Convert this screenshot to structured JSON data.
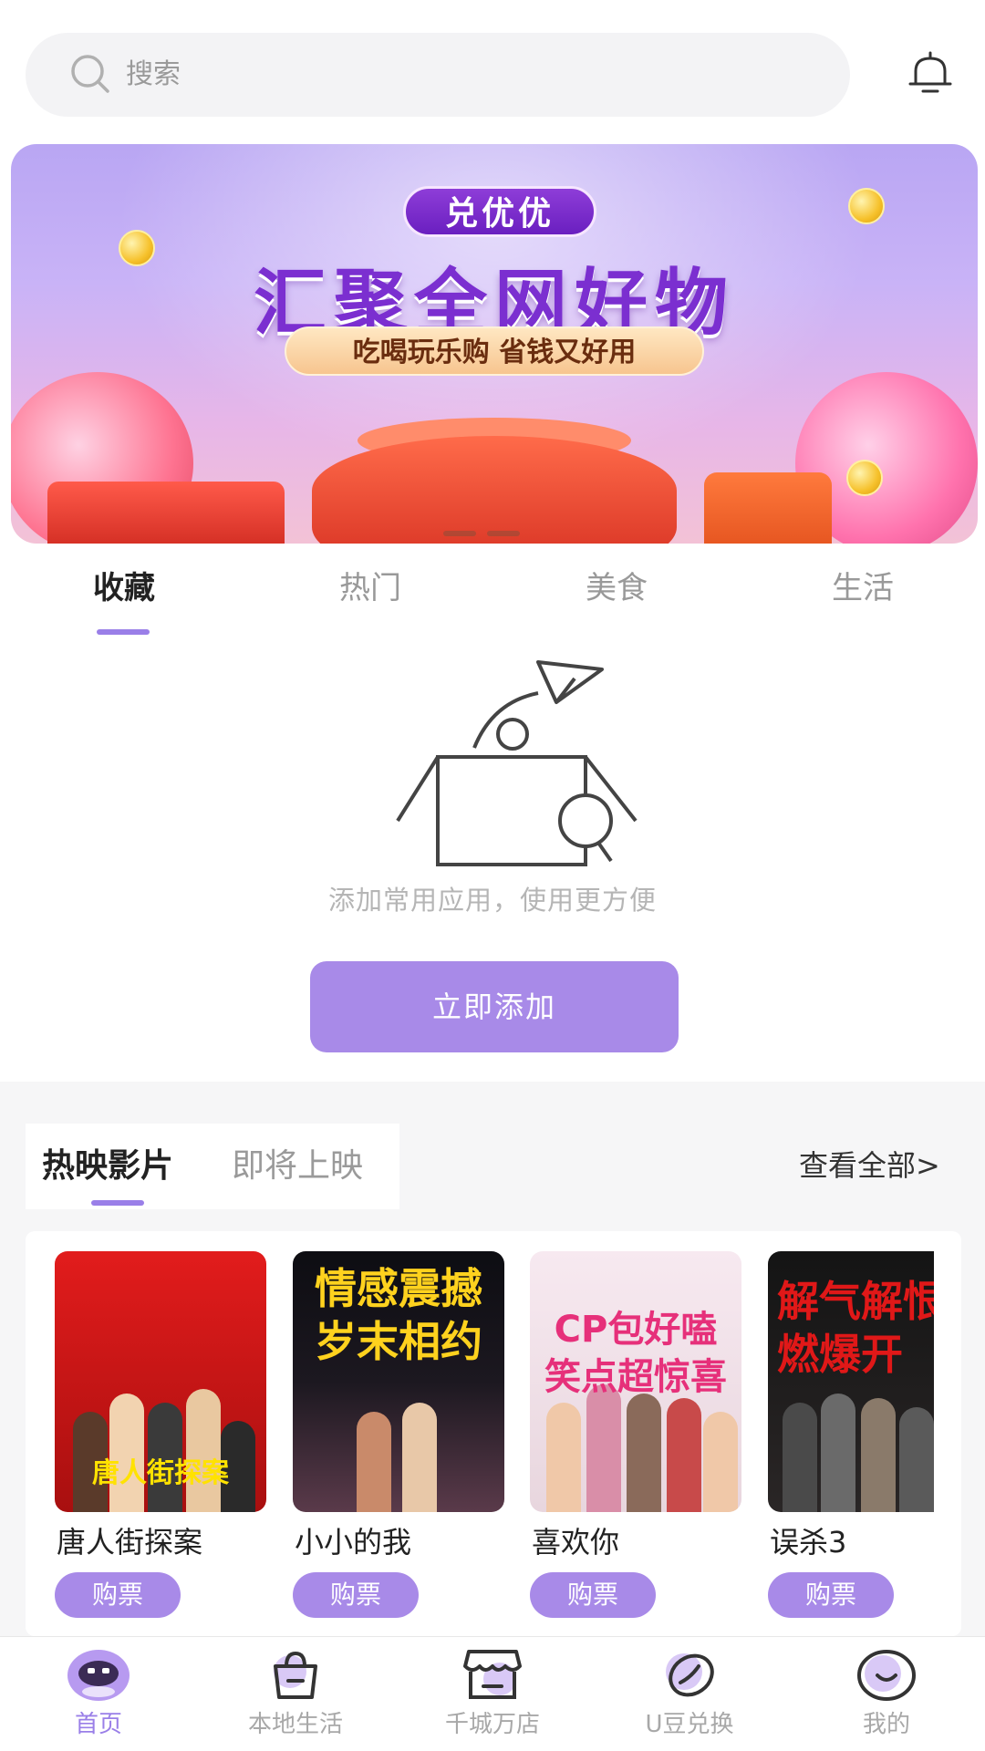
{
  "search": {
    "placeholder": "搜索",
    "icon": "search-icon"
  },
  "header": {
    "notification_icon": "bell-icon"
  },
  "banner": {
    "badge": "兑优优",
    "title": "汇聚全网好物",
    "subtitle": "吃喝玩乐购 省钱又好用",
    "page_indicator_count": 2
  },
  "tabs": [
    {
      "label": "收藏",
      "active": true
    },
    {
      "label": "热门",
      "active": false
    },
    {
      "label": "美食",
      "active": false
    },
    {
      "label": "生活",
      "active": false
    }
  ],
  "empty_state": {
    "text": "添加常用应用，使用更方便",
    "button_label": "立即添加"
  },
  "movies": {
    "tabs": [
      {
        "label": "热映影片",
        "active": true
      },
      {
        "label": "即将上映",
        "active": false
      }
    ],
    "see_all": "查看全部>",
    "items": [
      {
        "name": "唐人街探案",
        "buy_label": "购票",
        "poster_text": "唐人街探案"
      },
      {
        "name": "小小的我",
        "buy_label": "购票",
        "poster_text": "情感震撼岁末相约"
      },
      {
        "name": "喜欢你",
        "buy_label": "购票",
        "poster_text": "CP包好嗑笑点超惊喜"
      },
      {
        "name": "误杀3",
        "buy_label": "购票",
        "poster_text": "解气解恨燃爆开"
      }
    ]
  },
  "bottom_nav": [
    {
      "label": "首页",
      "icon": "robot-home-icon",
      "active": true
    },
    {
      "label": "本地生活",
      "icon": "shopping-bag-icon",
      "active": false
    },
    {
      "label": "千城万店",
      "icon": "storefront-icon",
      "active": false
    },
    {
      "label": "U豆兑换",
      "icon": "bean-exchange-icon",
      "active": false
    },
    {
      "label": "我的",
      "icon": "smile-profile-icon",
      "active": false
    }
  ],
  "colors": {
    "accent": "#9a7fe8",
    "button": "#a88ae8",
    "muted_text": "#9a9a9a"
  }
}
